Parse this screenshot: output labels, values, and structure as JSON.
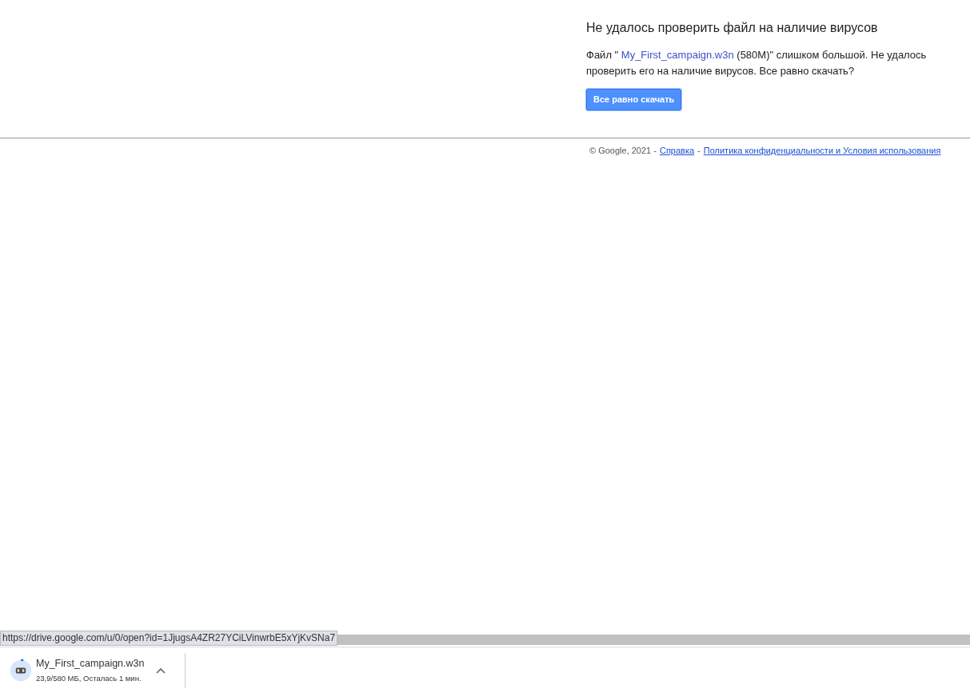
{
  "notice": {
    "title": "Не удалось проверить файл на наличие вирусов",
    "message": {
      "prefix": "Файл \" ",
      "link": "My_First_campaign.w3n",
      "suffix": " (580M)\" слишком большой. Не удалось проверить его на наличие вирусов. Все равно скачать?"
    },
    "button": "Все равно скачать"
  },
  "footer": {
    "copyright": "© Google, 2021 -",
    "help_link": "Справка",
    "separator": "-",
    "policy_link": "Политика конфиденциальности и Условия использования"
  },
  "status_url": "https://drive.google.com/u/0/open?id=1JjugsA4ZR27YCiLVinwrbE5xYjKvSNa7",
  "download": {
    "filename": "My_First_campaign.w3n",
    "progress": "23,9/580 МБ, Осталась 1 мин.",
    "level": 0.04
  }
}
